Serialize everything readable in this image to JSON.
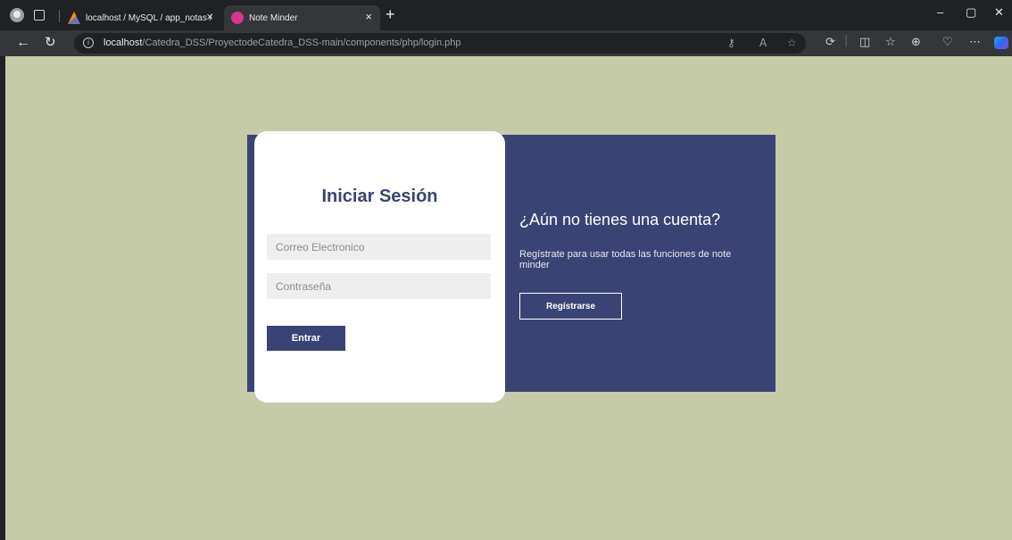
{
  "browser": {
    "tabs": [
      {
        "title": "localhost / MySQL / app_notas /",
        "active": false
      },
      {
        "title": "Note Minder",
        "active": true
      }
    ],
    "url_host": "localhost",
    "url_path": "/Catedra_DSS/ProyectodeCatedra_DSS-main/components/php/login.php"
  },
  "colors": {
    "page_background": "#c5cba9",
    "brand_navy": "#3a4474",
    "card_white": "#ffffff",
    "input_background": "#eeeeee"
  },
  "login": {
    "title": "Iniciar Sesión",
    "email_placeholder": "Correo Electronico",
    "password_placeholder": "Contraseña",
    "submit_label": "Entrar"
  },
  "signup": {
    "title": "¿Aún no tienes una cuenta?",
    "text": "Regístrate para usar todas las funciones de note minder",
    "button_label": "Regístrarse"
  }
}
